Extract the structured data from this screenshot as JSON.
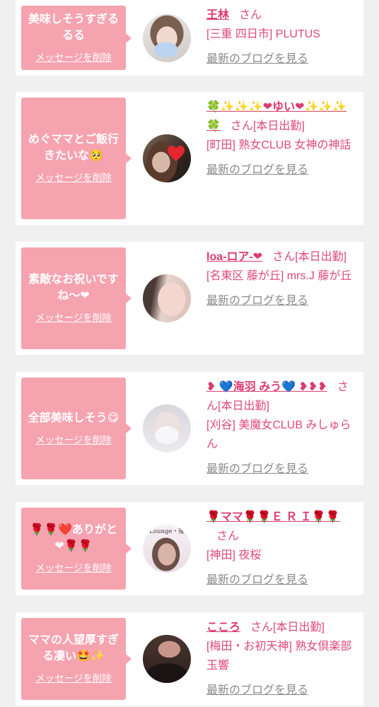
{
  "colors": {
    "page_background": "#f0f0f0",
    "card_background": "#ffffff",
    "bubble": "#f6a3b0",
    "bubble_text": "#ffffff",
    "name": "#dc3b70",
    "detail_text": "#e0487c",
    "blog_link": "#8a8a8a"
  },
  "cards": [
    {
      "message": "美味しそうすぎるるる",
      "delete_label": "メッセージを削除",
      "name": "王林",
      "honorific": "さん",
      "area": "[三重 四日市] PLUTUS",
      "blog_label": "最新のブログを見る"
    },
    {
      "message": "めぐママとご飯行きたいな🥺",
      "delete_label": "メッセージを削除",
      "name": "🍀✨✨✨❤ゆい❤✨✨✨🍀",
      "honorific": "さん",
      "status": "[本日出勤]",
      "area": "[町田] 熟女CLUB 女神の神話",
      "blog_label": "最新のブログを見る"
    },
    {
      "message": "素敵なお祝いですね〜❤",
      "delete_label": "メッセージを削除",
      "name": "loa-ロア-❤",
      "honorific": "さん",
      "status": "[本日出勤]",
      "area": "[名東区 藤が丘] mrs.J 藤が丘",
      "blog_label": "最新のブログを見る"
    },
    {
      "message": "全部美味しそう😋",
      "delete_label": "メッセージを削除",
      "name": "❥ 💙海羽 みう💙 ❥❥❥",
      "honorific": "さん",
      "status": "[本日出勤]",
      "area": "[刈谷] 美魔女CLUB みしゅらん",
      "blog_label": "最新のブログを見る"
    },
    {
      "message": "🌹🌹❤️ありがと❤🌹🌹",
      "delete_label": "メッセージを削除",
      "avatar_logo_text": "Lounge・夜",
      "name": "🌹ママ🌹🌹Ｅ Ｒ Ｉ🌹🌹",
      "honorific": "さん",
      "area": "[神田] 夜桜",
      "blog_label": "最新のブログを見る"
    },
    {
      "message": "ママの人望厚すぎる凄い🤩✨",
      "delete_label": "メッセージを削除",
      "name": "こころ",
      "honorific": "さん",
      "status": "[本日出勤]",
      "area": "[梅田・お初天神] 熟女倶楽部 玉響",
      "blog_label": "最新のブログを見る"
    }
  ]
}
